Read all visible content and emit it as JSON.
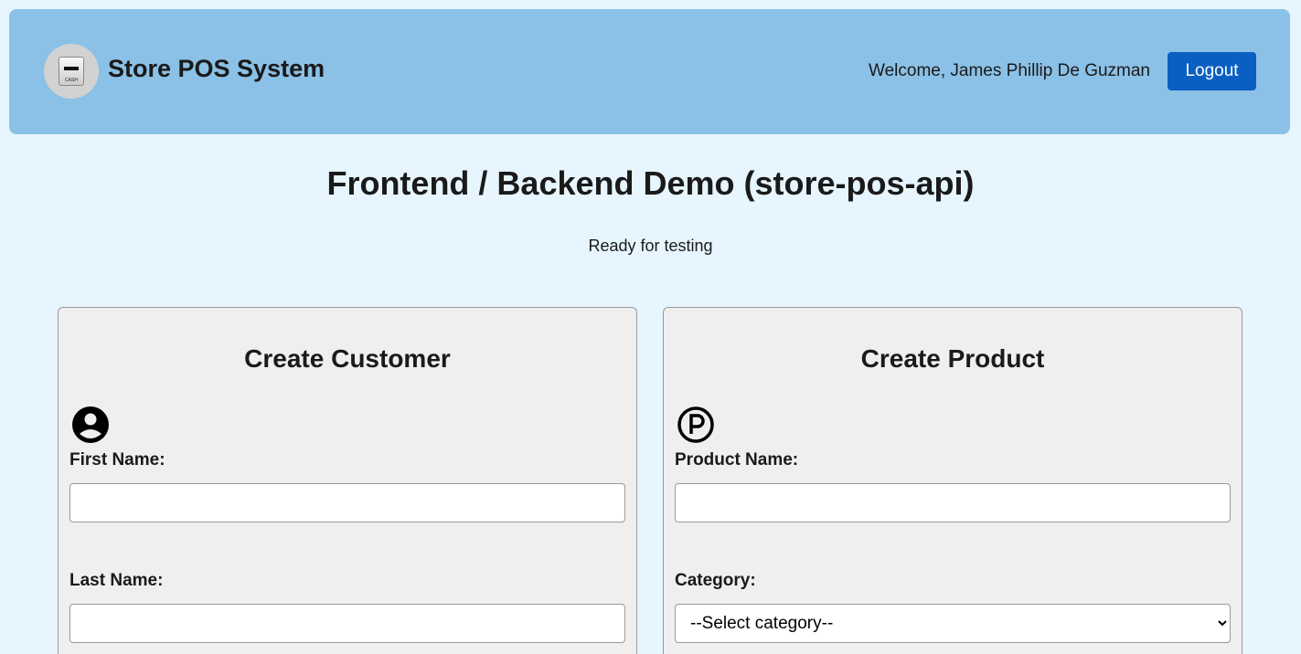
{
  "header": {
    "app_title": "Store POS System",
    "logo_text": "CASH",
    "welcome": "Welcome, James Phillip De Guzman",
    "logout_label": "Logout"
  },
  "main": {
    "title": "Frontend / Backend Demo (store-pos-api)",
    "status": "Ready for testing"
  },
  "customer_card": {
    "title": "Create Customer",
    "first_name_label": "First Name:",
    "first_name_value": "",
    "last_name_label": "Last Name:",
    "last_name_value": ""
  },
  "product_card": {
    "title": "Create Product",
    "product_name_label": "Product Name:",
    "product_name_value": "",
    "category_label": "Category:",
    "category_selected": "--Select category--"
  }
}
